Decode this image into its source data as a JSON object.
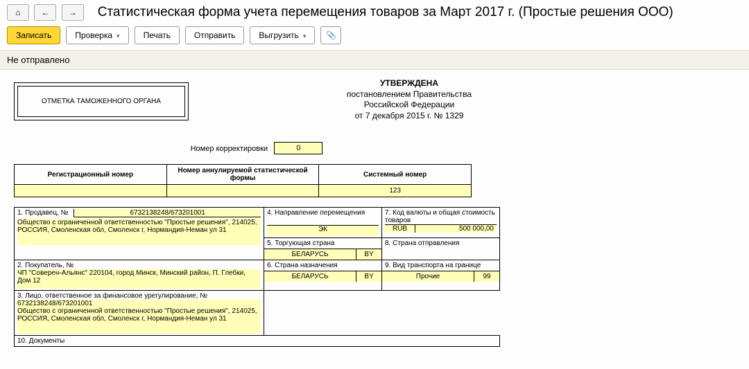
{
  "nav": {
    "home_icon": "⌂",
    "back_icon": "←",
    "fwd_icon": "→"
  },
  "title": "Статистическая форма учета перемещения товаров за Март 2017 г. (Простые решения ООО)",
  "toolbar": {
    "record": "Записать",
    "check": "Проверка",
    "print": "Печать",
    "send": "Отправить",
    "export": "Выгрузить",
    "attach_icon": "📎"
  },
  "status": "Не отправлено",
  "doc": {
    "stamp": "ОТМЕТКА ТАМОЖЕННОГО ОРГАНА",
    "approval": {
      "h": "УТВЕРЖДЕНА",
      "l1": "постановлением Правительства",
      "l2": "Российской Федерации",
      "l3": "от 7 декабря 2015 г. № 1329"
    },
    "correction": {
      "label": "Номер корректировки",
      "value": "0"
    },
    "head": {
      "reg_label": "Регистрационный номер",
      "ann_label": "Номер аннулируемой статистической формы",
      "sys_label": "Системный номер",
      "reg_value": "",
      "ann_value": "",
      "sys_value": "123"
    },
    "seller": {
      "label": "1. Продавец, №",
      "num": "6732138248/673201001",
      "text": "Общество с ограниченной ответственностью \"Простые решения\", 214025, РОССИЯ, Смоленская обл, Смоленск г, Нормандия-Неман ул 31"
    },
    "buyer": {
      "label": "2. Покупатель, №",
      "text": "ЧП \"Соверен-Альянс\"  220104, город Минск, Минский район, П. Глебки, Дом 12"
    },
    "finresp": {
      "label": "3. Лицо, ответственное за финансовое урегулирование, №",
      "num": "6732138248/673201001",
      "text": "Общество с ограниченной ответственностью \"Простые решения\", 214025, РОССИЯ, Смоленская обл, Смоленск г, Нормандия-Неман ул 31"
    },
    "direction": {
      "label": "4. Направление перемещения",
      "value": "ЭК"
    },
    "trade_country": {
      "label": "5. Торгующая страна",
      "name": "БЕЛАРУСЬ",
      "code": "BY"
    },
    "dest_country": {
      "label": "6. Страна назначения",
      "name": "БЕЛАРУСЬ",
      "code": "BY"
    },
    "currency": {
      "label": "7. Код валюты и общая стоимость товаров",
      "code": "RUB",
      "amount": "500 000,00"
    },
    "origin_country": {
      "label": "8. Страна отправления"
    },
    "transport": {
      "label": "9. Вид транспорта на границе",
      "name": "Прочие",
      "code": "99"
    },
    "documents_label": "10. Документы"
  }
}
